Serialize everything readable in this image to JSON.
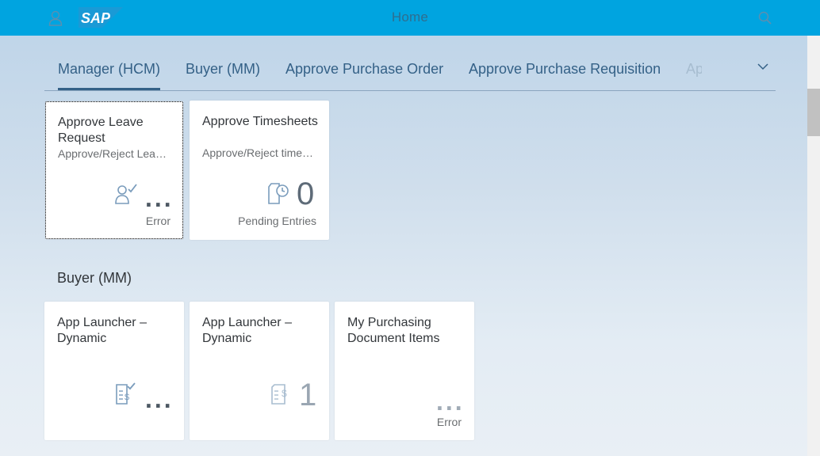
{
  "shell": {
    "title": "Home",
    "logo": "SAP"
  },
  "tabs": [
    {
      "label": "Manager (HCM)",
      "selected": true
    },
    {
      "label": "Buyer (MM)"
    },
    {
      "label": "Approve Purchase Order"
    },
    {
      "label": "Approve Purchase Requisition"
    },
    {
      "label": "Ap"
    }
  ],
  "group1": {
    "tiles": [
      {
        "title": "Approve Leave Request",
        "subtitle": "Approve/Reject Lea…",
        "value": "...",
        "footer": "Error",
        "icon": "employee-approvals-icon"
      },
      {
        "title": "Approve Timesheets",
        "subtitle": "Approve/Reject time…",
        "value": "0",
        "footer": "Pending Entries",
        "icon": "time-entry-request-icon"
      }
    ]
  },
  "group2": {
    "title": "Buyer (MM)",
    "tiles": [
      {
        "title": "App Launcher – Dynamic",
        "value": "...",
        "icon": "approved-document-icon"
      },
      {
        "title": "App Launcher – Dynamic",
        "value": "1",
        "icon": "document-cost-icon"
      },
      {
        "title": "My Purchasing Document Items",
        "value": "...",
        "footer": "Error"
      }
    ]
  },
  "colors": {
    "shellbar": "#00a4e0",
    "tab_text": "#346187",
    "tile_bg": "#ffffff"
  }
}
